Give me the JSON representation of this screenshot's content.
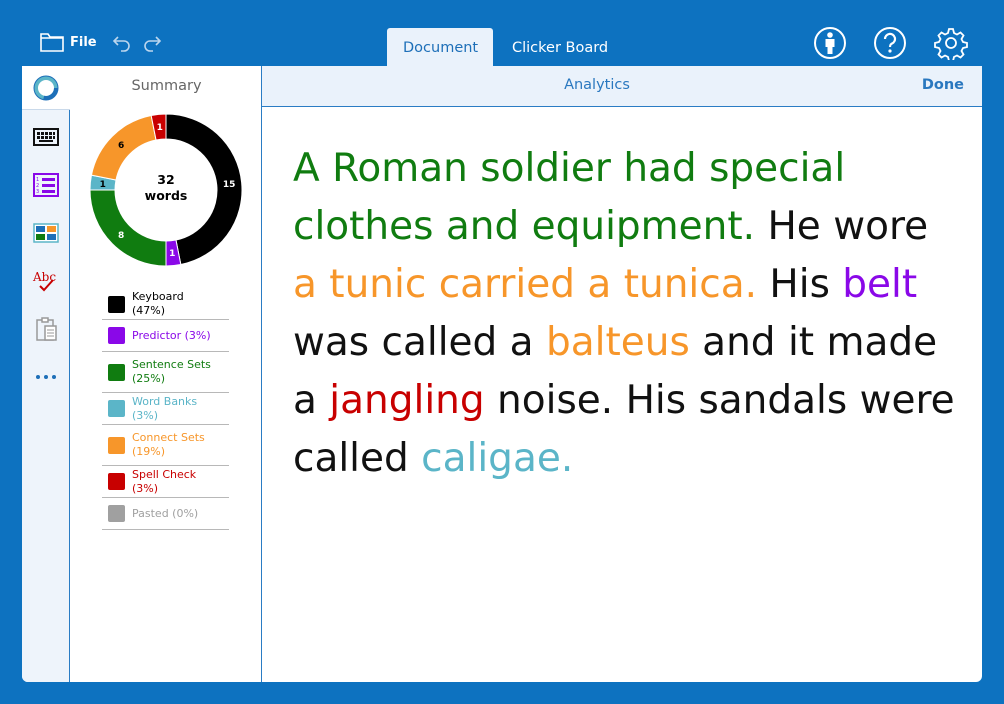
{
  "topbar": {
    "file_label": "File",
    "tabs": [
      {
        "label": "Document",
        "active": true
      },
      {
        "label": "Clicker Board",
        "active": false
      }
    ]
  },
  "icons": {
    "file": "folder-icon",
    "undo": "undo-icon",
    "redo": "redo-icon",
    "person": "person-icon",
    "help": "help-icon",
    "settings": "gear-icon"
  },
  "sidebar": {
    "items": [
      {
        "icon": "analytics-icon",
        "active": true
      },
      {
        "icon": "keyboard-icon"
      },
      {
        "icon": "sentence-sets-icon"
      },
      {
        "icon": "word-banks-icon"
      },
      {
        "icon": "spell-check-icon"
      },
      {
        "icon": "clipboard-icon"
      },
      {
        "icon": "more-icon"
      }
    ]
  },
  "summary": {
    "title": "Summary",
    "total_count": "32",
    "total_unit": "words"
  },
  "chart_data": {
    "type": "pie",
    "segments": [
      {
        "name": "Keyboard",
        "value": 15,
        "color": "#000000"
      },
      {
        "name": "Predictor",
        "value": 1,
        "color": "#8a08e8"
      },
      {
        "name": "Sentence Sets",
        "value": 8,
        "color": "#107c10"
      },
      {
        "name": "Word Banks",
        "value": 1,
        "color": "#5bb5c8"
      },
      {
        "name": "Connect Sets",
        "value": 6,
        "color": "#f7962a"
      },
      {
        "name": "Spell Check",
        "value": 1,
        "color": "#c80000"
      }
    ]
  },
  "legend": [
    {
      "label": "Keyboard (47%)",
      "color": "#000000",
      "text_color": "#000000"
    },
    {
      "label": "Predictor (3%)",
      "color": "#8a08e8",
      "text_color": "#8a08e8"
    },
    {
      "label": "Sentence Sets (25%)",
      "color": "#107c10",
      "text_color": "#107c10"
    },
    {
      "label": "Word Banks (3%)",
      "color": "#5bb5c8",
      "text_color": "#5bb5c8"
    },
    {
      "label": "Connect Sets (19%)",
      "color": "#f7962a",
      "text_color": "#f7962a"
    },
    {
      "label": "Spell Check (3%)",
      "color": "#c80000",
      "text_color": "#c80000"
    },
    {
      "label": "Pasted (0%)",
      "color": "#a0a0a0",
      "text_color": "#a0a0a0"
    }
  ],
  "main": {
    "title": "Analytics",
    "done_label": "Done"
  },
  "document": {
    "runs": [
      {
        "text": "A Roman soldier had special clothes and equipment.",
        "color": "#107c10"
      },
      {
        "text": " He wore ",
        "color": "#111111"
      },
      {
        "text": "a tunic carried a tunica.",
        "color": "#f7962a"
      },
      {
        "text": " His ",
        "color": "#111111"
      },
      {
        "text": "belt",
        "color": "#8a08e8"
      },
      {
        "text": " was called a ",
        "color": "#111111"
      },
      {
        "text": "balteus",
        "color": "#f7962a"
      },
      {
        "text": " and it made a ",
        "color": "#111111"
      },
      {
        "text": "jangling",
        "color": "#c80000"
      },
      {
        "text": " noise. His sandals were called ",
        "color": "#111111"
      },
      {
        "text": "caligae.",
        "color": "#5bb5c8"
      }
    ]
  }
}
